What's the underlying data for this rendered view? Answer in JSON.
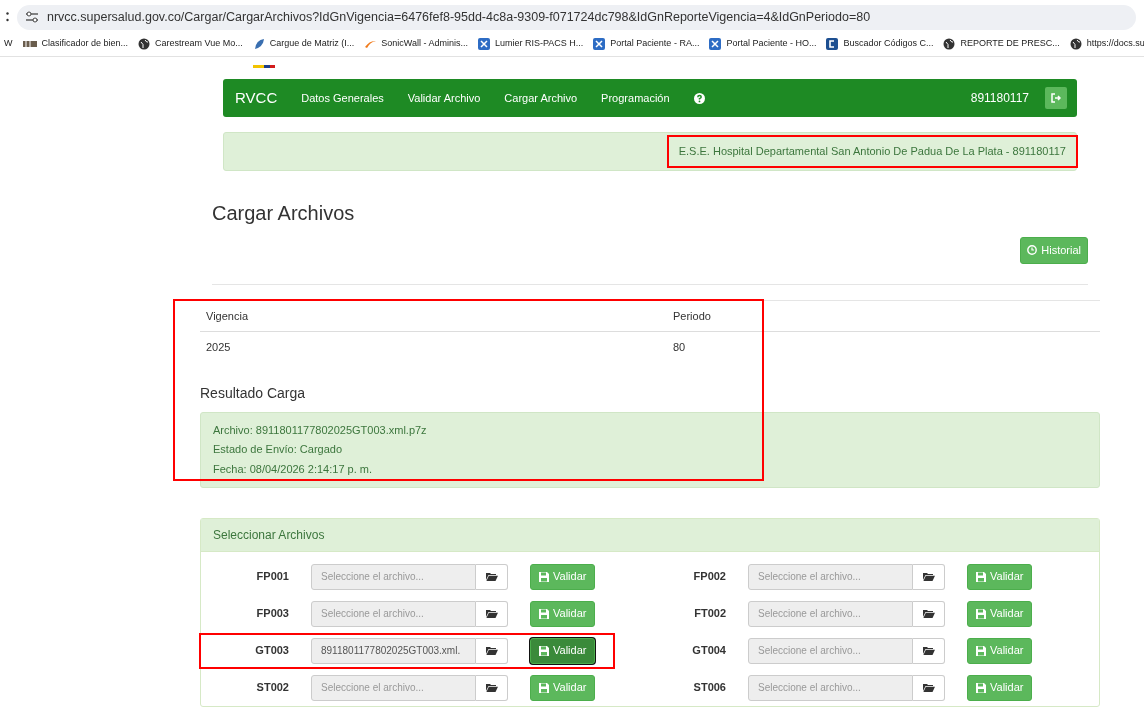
{
  "browser": {
    "url": "nrvcc.supersalud.gov.co/Cargar/CargarArchivos?IdGnVigencia=6476fef8-95dd-4c8a-9309-f071724dc798&IdGnReporteVigencia=4&IdGnPeriodo=80",
    "bookmarks": [
      {
        "label": "W",
        "kind": "none"
      },
      {
        "label": "Clasificador de bien...",
        "kind": "bars"
      },
      {
        "label": "Carestream Vue Mo...",
        "kind": "globe"
      },
      {
        "label": "Cargue de Matriz (I...",
        "kind": "leaf"
      },
      {
        "label": "SonicWall - Adminis...",
        "kind": "swoosh"
      },
      {
        "label": "Lumier RIS-PACS H...",
        "kind": "tile"
      },
      {
        "label": "Portal Paciente - RA...",
        "kind": "tile"
      },
      {
        "label": "Portal Paciente - HO...",
        "kind": "tile"
      },
      {
        "label": "Buscador Códigos C...",
        "kind": "app"
      },
      {
        "label": "REPORTE DE PRESC...",
        "kind": "globe"
      },
      {
        "label": "https://docs.su",
        "kind": "globe"
      }
    ]
  },
  "navbar": {
    "brand": "RVCC",
    "links": [
      {
        "label": "Datos Generales"
      },
      {
        "label": "Validar Archivo"
      },
      {
        "label": "Cargar Archivo"
      },
      {
        "label": "Programación"
      }
    ],
    "user": "891180117"
  },
  "entity_banner": {
    "text": "E.S.E. Hospital Departamental San Antonio De Padua De La Plata - 891180117",
    "highlighted": true
  },
  "title": "Cargar Archivos",
  "history_button": "Historial",
  "summary": {
    "highlighted": true,
    "columns": [
      "Vigencia",
      "Periodo"
    ],
    "values": [
      "2025",
      "80"
    ],
    "result_title": "Resultado Carga",
    "result_lines": [
      "Archivo: 8911801177802025GT003.xml.p7z",
      "Estado de Envío: Cargado",
      "Fecha: 08/04/2026 2:14:17 p. m."
    ]
  },
  "files_panel": {
    "title": "Seleccionar Archivos",
    "rows": [
      [
        {
          "code": "FP001",
          "placeholder": "Seleccione el archivo...",
          "button": "Validar",
          "highlighted": false,
          "focused": false
        },
        {
          "code": "FP002",
          "placeholder": "Seleccione el archivo...",
          "button": "Validar",
          "highlighted": false,
          "focused": false
        }
      ],
      [
        {
          "code": "FP003",
          "placeholder": "Seleccione el archivo...",
          "button": "Validar",
          "highlighted": false,
          "focused": false
        },
        {
          "code": "FT002",
          "placeholder": "Seleccione el archivo...",
          "button": "Validar",
          "highlighted": false,
          "focused": false
        }
      ],
      [
        {
          "code": "GT003",
          "value": "8911801177802025GT003.xml.",
          "button": "Validar",
          "highlighted": true,
          "focused": true
        },
        {
          "code": "GT004",
          "placeholder": "Seleccione el archivo...",
          "button": "Validar",
          "highlighted": false,
          "focused": false
        }
      ],
      [
        {
          "code": "ST002",
          "placeholder": "Seleccione el archivo...",
          "button": "Validar",
          "highlighted": false,
          "focused": false
        },
        {
          "code": "ST006",
          "placeholder": "Seleccione el archivo...",
          "button": "Validar",
          "highlighted": false,
          "focused": false
        }
      ]
    ]
  }
}
